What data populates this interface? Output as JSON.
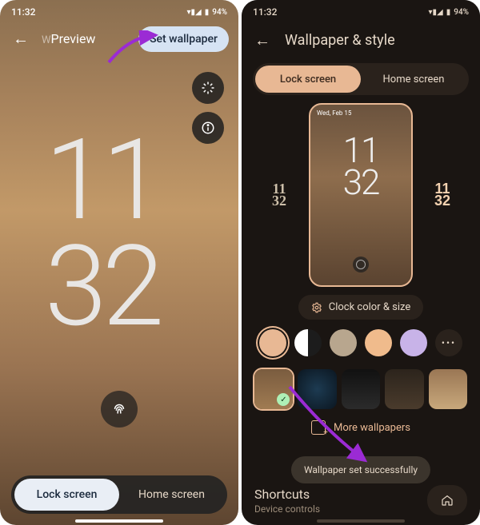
{
  "status": {
    "time_left": "11:32",
    "time_right": "11:32",
    "battery": "94%",
    "signal": "▴◢"
  },
  "left": {
    "title_pre": "W",
    "title": "Preview",
    "set_wallpaper": "Set wallpaper",
    "clock_h": "11",
    "clock_m": "32",
    "tabs": {
      "lock": "Lock screen",
      "home": "Home screen"
    }
  },
  "right": {
    "title": "Wallpaper & style",
    "tabs": {
      "lock": "Lock screen",
      "home": "Home screen"
    },
    "mini_time": "Wed, Feb 15",
    "mini_clock_h": "11",
    "mini_clock_m": "32",
    "alt_clock_1": "11\n32",
    "alt_clock_2": "11\n32",
    "ccs": "Clock color & size",
    "swatches": [
      "#e8b894",
      "#f5f1eb",
      "#b8a68e",
      "#f0bb8c",
      "#c8b3e8"
    ],
    "more_wallpapers": "More wallpapers",
    "toast": "Wallpaper set successfully",
    "shortcuts": {
      "title": "Shortcuts",
      "sub": "Device controls"
    }
  }
}
